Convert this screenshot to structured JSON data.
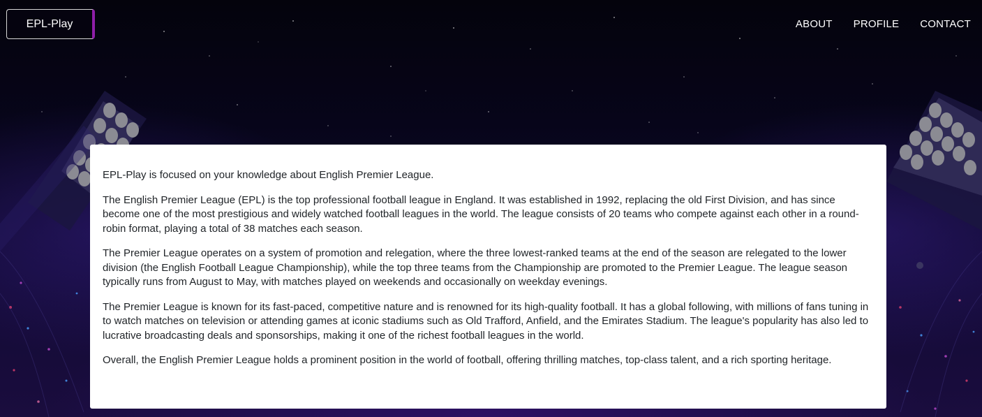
{
  "header": {
    "brand_label": "EPL-Play",
    "nav_items": [
      {
        "label": "ABOUT"
      },
      {
        "label": "PROFILE"
      },
      {
        "label": "CONTACT"
      }
    ]
  },
  "main": {
    "paragraphs": [
      "EPL-Play is focused on your knowledge about English Premier League.",
      "The English Premier League (EPL) is the top professional football league in England. It was established in 1992, replacing the old First Division, and has since become one of the most prestigious and widely watched football leagues in the world. The league consists of 20 teams who compete against each other in a round-robin format, playing a total of 38 matches each season.",
      "The Premier League operates on a system of promotion and relegation, where the three lowest-ranked teams at the end of the season are relegated to the lower division (the English Football League Championship), while the top three teams from the Championship are promoted to the Premier League. The league season typically runs from August to May, with matches played on weekends and occasionally on weekday evenings.",
      "The Premier League is known for its fast-paced, competitive nature and is renowned for its high-quality football. It has a global following, with millions of fans tuning in to watch matches on television or attending games at iconic stadiums such as Old Trafford, Anfield, and the Emirates Stadium. The league's popularity has also led to lucrative broadcasting deals and sponsorships, making it one of the richest football leagues in the world.",
      "Overall, the English Premier League holds a prominent position in the world of football, offering thrilling matches, top-class talent, and a rich sporting heritage."
    ]
  },
  "colors": {
    "background": "#05030f",
    "accent": "#8e1ea8",
    "card": "#ffffff",
    "text": "#212529"
  },
  "icons": {
    "background": "stadium-floodlights-night-background"
  }
}
